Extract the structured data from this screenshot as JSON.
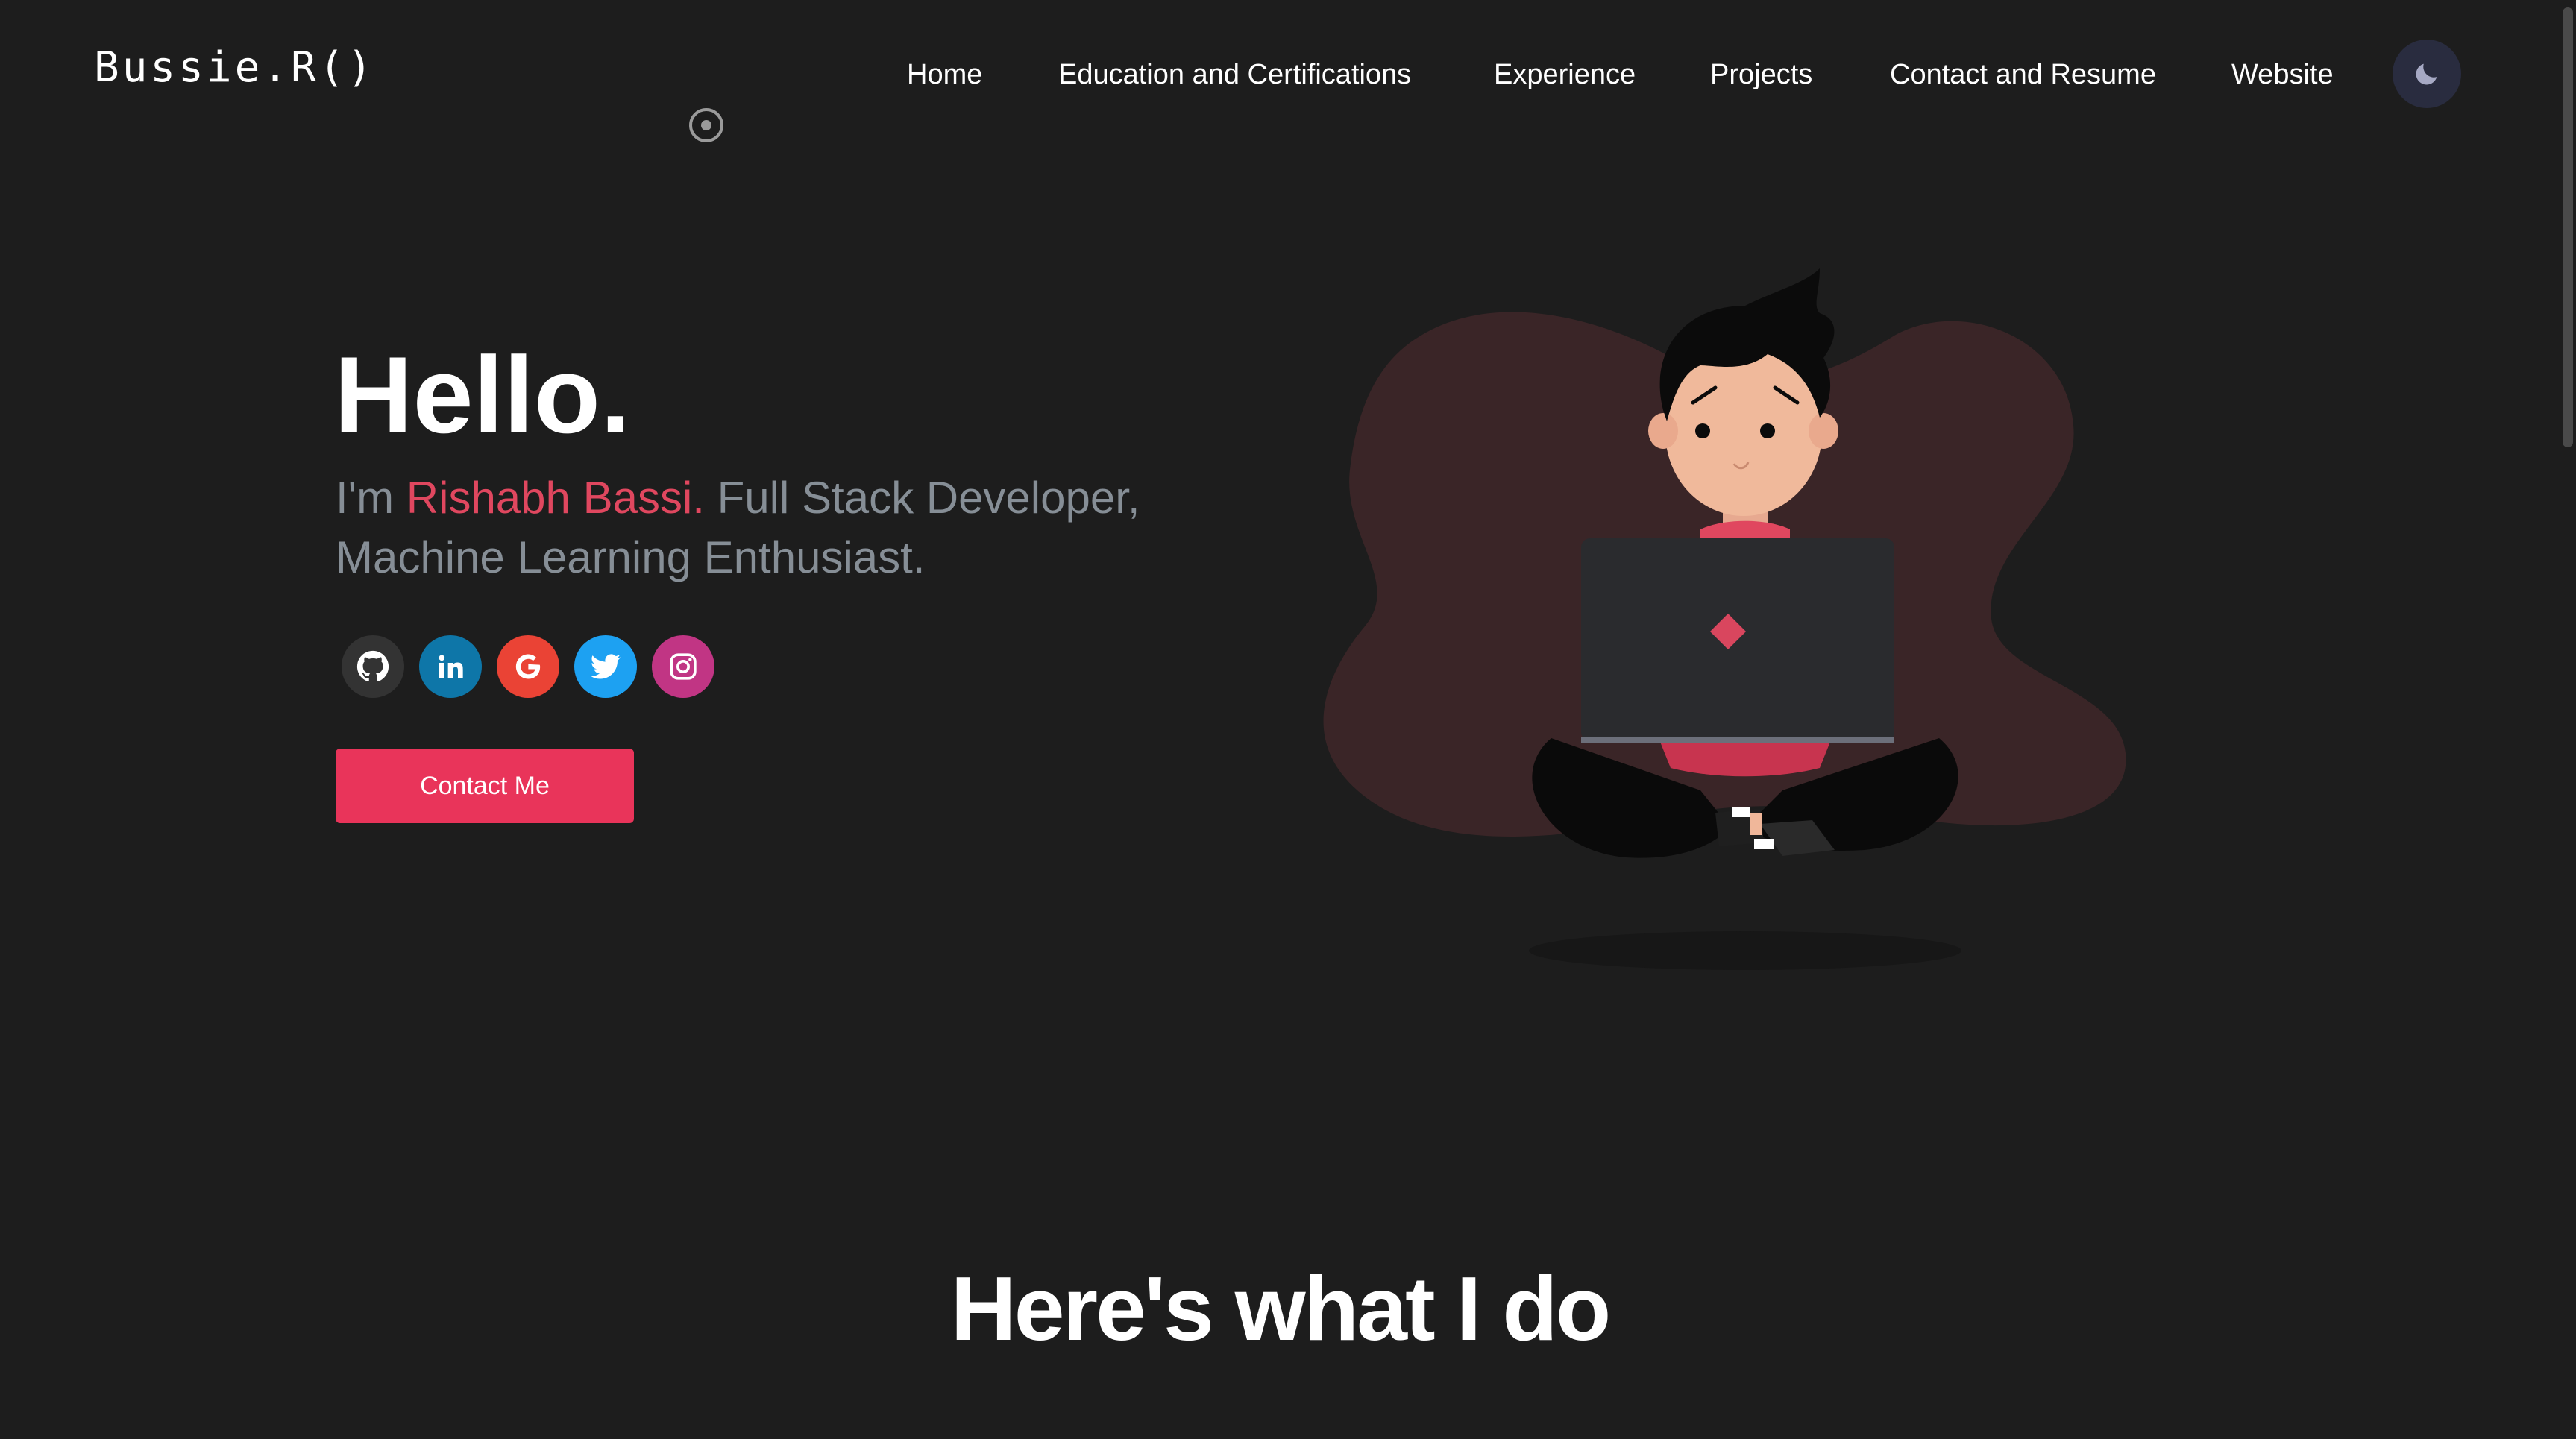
{
  "header": {
    "logo": "Bussie.R()",
    "nav": [
      {
        "label": "Home"
      },
      {
        "label": "Education and Certifications"
      },
      {
        "label": "Experience"
      },
      {
        "label": "Projects"
      },
      {
        "label": "Contact and Resume"
      },
      {
        "label": "Website"
      }
    ],
    "theme_toggle_icon": "moon-icon"
  },
  "hero": {
    "greeting": "Hello.",
    "intro_prefix": "I'm ",
    "name": "Rishabh Bassi.",
    "intro_suffix": " Full Stack Developer, Machine Learning Enthusiast.",
    "socials": [
      {
        "icon": "github-icon",
        "color": "#333333"
      },
      {
        "icon": "linkedin-icon",
        "color": "#0e76a8"
      },
      {
        "icon": "google-icon",
        "color": "#ea4335"
      },
      {
        "icon": "twitter-icon",
        "color": "#1da1f2"
      },
      {
        "icon": "instagram-icon",
        "color": "#c13584"
      }
    ],
    "contact_button": "Contact Me"
  },
  "sections": {
    "what_i_do_title": "Here's what I do"
  },
  "colors": {
    "background": "#1d1d1d",
    "accent": "#e9345a",
    "name_highlight": "#e0475f",
    "subtitle_text": "#868e96"
  }
}
